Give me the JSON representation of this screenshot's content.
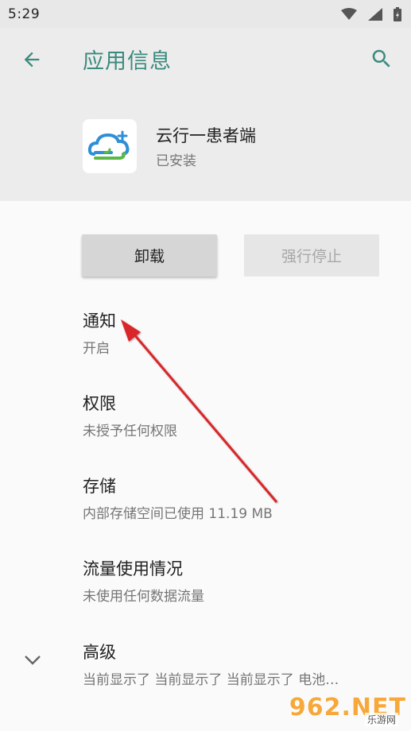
{
  "status_bar": {
    "time": "5:29"
  },
  "toolbar": {
    "title": "应用信息"
  },
  "app": {
    "name": "云行一患者端",
    "status": "已安装"
  },
  "buttons": {
    "uninstall": "卸载",
    "force_stop": "强行停止"
  },
  "settings": [
    {
      "title": "通知",
      "subtitle": "开启"
    },
    {
      "title": "权限",
      "subtitle": "未授予任何权限"
    },
    {
      "title": "存储",
      "subtitle": "内部存储空间已使用 11.19 MB"
    },
    {
      "title": "流量使用情况",
      "subtitle": "未使用任何数据流量"
    },
    {
      "title": "高级",
      "subtitle": "当前显示了 当前显示了 当前显示了 电池…"
    }
  ],
  "watermark": {
    "main": "962.NET",
    "sub": "乐游网"
  },
  "colors": {
    "accent": "#3a8a7e",
    "annotation_arrow": "#d9262b",
    "header_bg": "#ececec"
  }
}
